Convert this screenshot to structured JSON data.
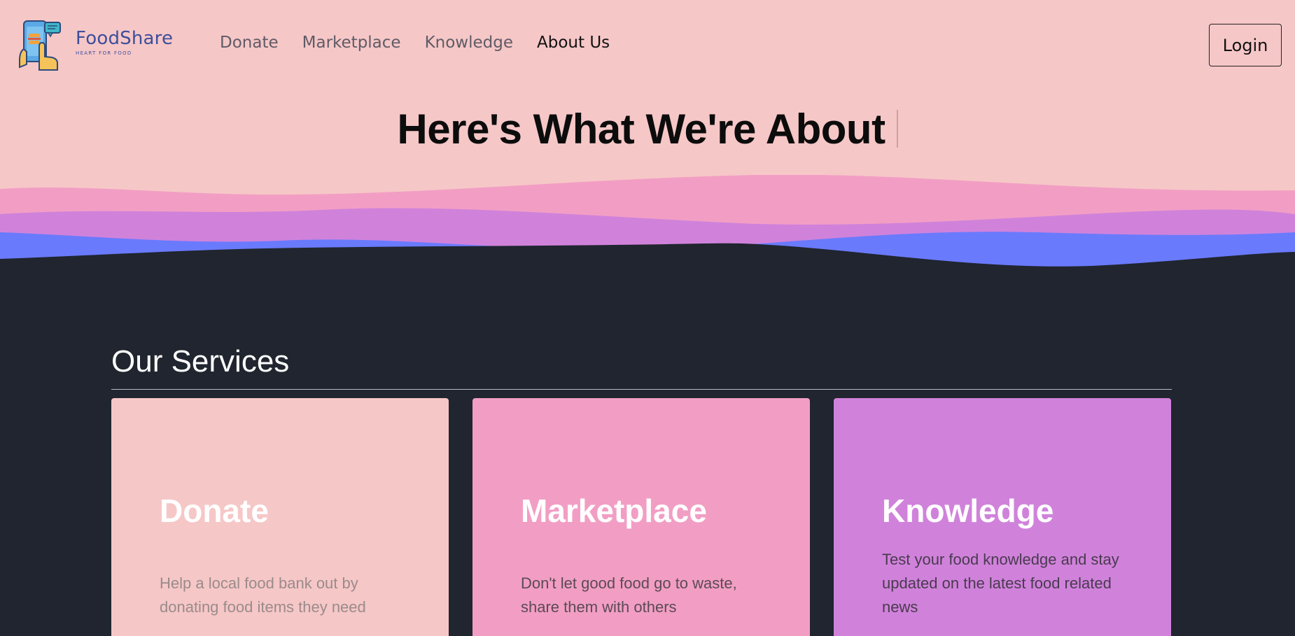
{
  "brand": {
    "name": "FoodShare",
    "tagline": "HEART FOR FOOD"
  },
  "nav": {
    "links": [
      {
        "label": "Donate"
      },
      {
        "label": "Marketplace"
      },
      {
        "label": "Knowledge"
      },
      {
        "label": "About Us"
      }
    ],
    "active": "About Us",
    "login_label": "Login"
  },
  "hero": {
    "title": "Here's What We're About"
  },
  "services": {
    "title": "Our Services",
    "cards": [
      {
        "title": "Donate",
        "text": "Help a local food bank out by donating food items they need"
      },
      {
        "title": "Marketplace",
        "text": "Don't let good food go to waste, share them with others"
      },
      {
        "title": "Knowledge",
        "text": "Test your food knowledge and stay updated on the latest food related news"
      }
    ]
  },
  "colors": {
    "hero_bg": "#f6c7c7",
    "wave_pink": "#f29ec4",
    "wave_purple": "#d082db",
    "wave_blue": "#6a7afc",
    "page_bg": "#20252f"
  },
  "icons": {
    "logo": "phone-hand-chat-icon"
  }
}
